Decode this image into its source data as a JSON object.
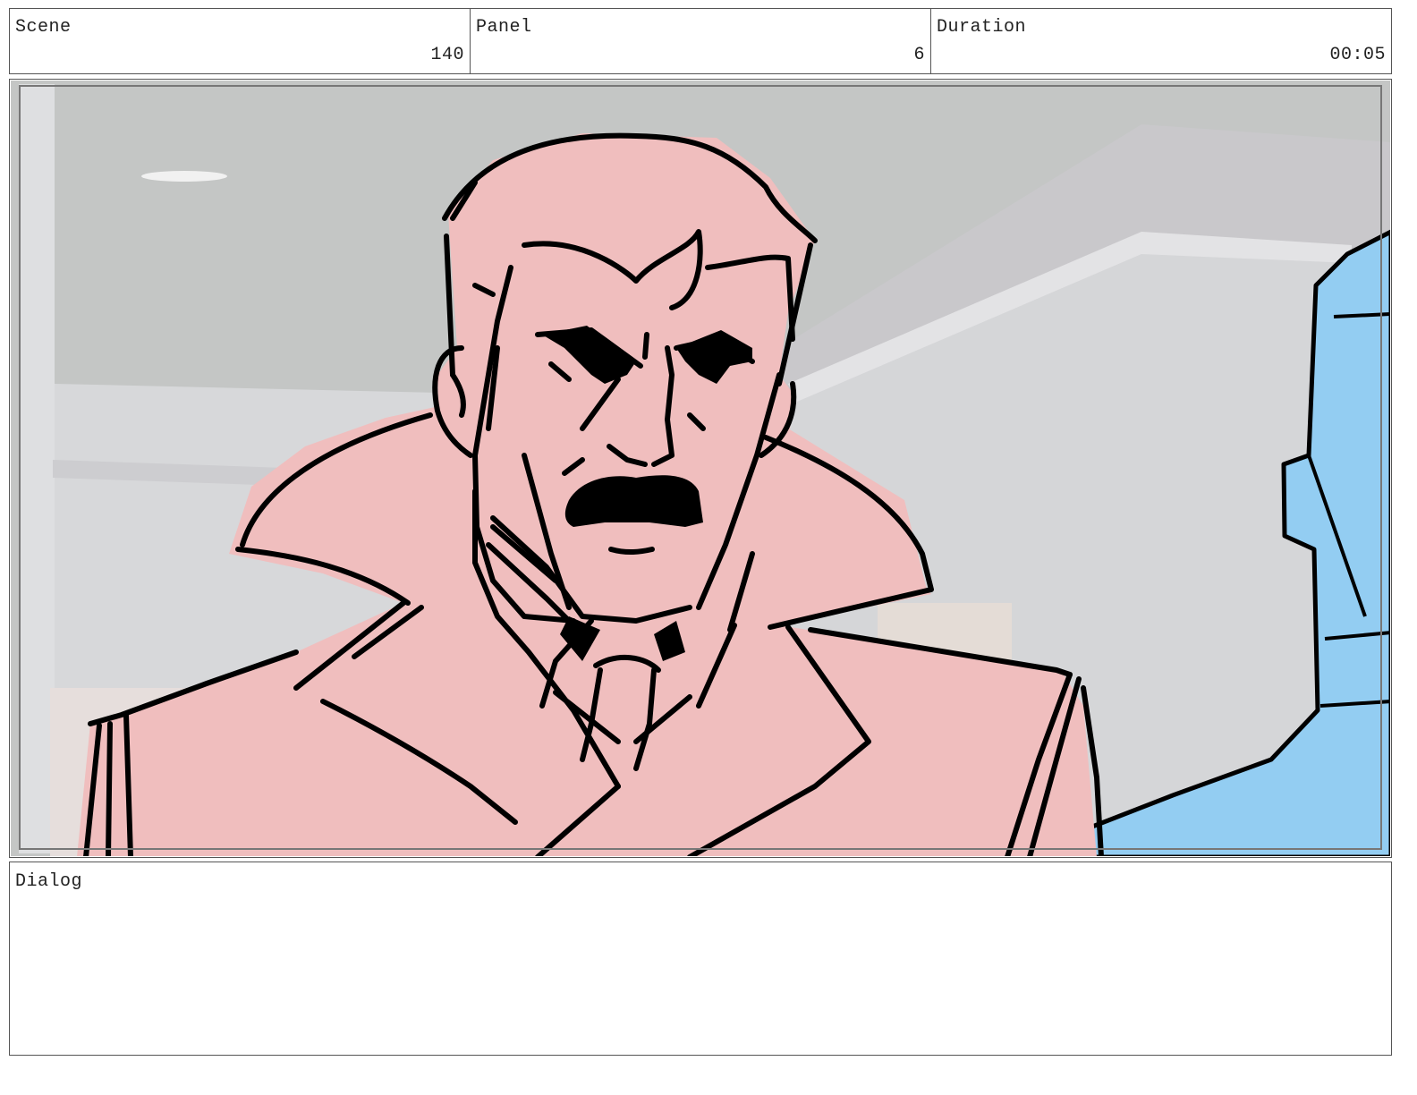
{
  "header": {
    "scene_label": "Scene",
    "scene_value": "140",
    "panel_label": "Panel",
    "panel_value": "6",
    "duration_label": "Duration",
    "duration_value": "00:05"
  },
  "dialog": {
    "label": "Dialog",
    "text": ""
  },
  "colors": {
    "character_fill": "#f0bebe",
    "second_character_fill": "#93cdf2",
    "background_gray": "#c4c6c5",
    "line_art": "#000000"
  }
}
